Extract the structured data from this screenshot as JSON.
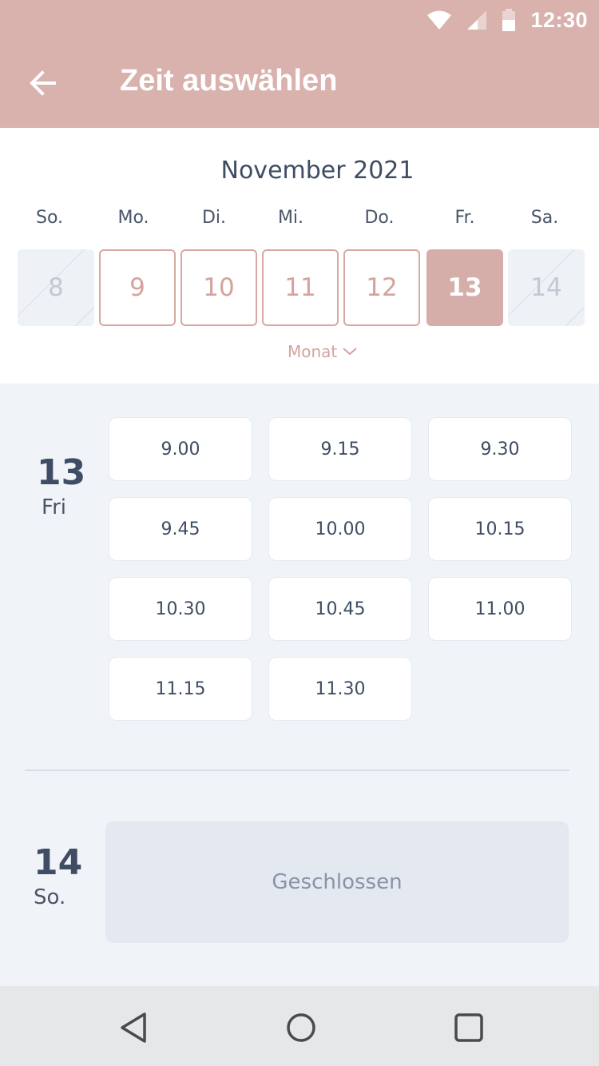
{
  "status": {
    "time": "12:30"
  },
  "header": {
    "title": "Zeit auswählen",
    "back_icon": "arrow-left-icon"
  },
  "calendar": {
    "month": "November 2021",
    "weekdays": [
      "So.",
      "Mo.",
      "Di.",
      "Mi.",
      "Do.",
      "Fr.",
      "Sa."
    ],
    "days": [
      {
        "num": "8",
        "state": "closed"
      },
      {
        "num": "9",
        "state": "open"
      },
      {
        "num": "10",
        "state": "open"
      },
      {
        "num": "11",
        "state": "open"
      },
      {
        "num": "12",
        "state": "open"
      },
      {
        "num": "13",
        "state": "selected"
      },
      {
        "num": "14",
        "state": "closed"
      }
    ],
    "month_toggle": "Monat"
  },
  "day1": {
    "num": "13",
    "name": "Fri",
    "slots": [
      "9.00",
      "9.15",
      "9.30",
      "9.45",
      "10.00",
      "10.15",
      "10.30",
      "10.45",
      "11.00",
      "11.15",
      "11.30"
    ]
  },
  "day2": {
    "num": "14",
    "name": "So.",
    "closed_text": "Geschlossen"
  },
  "colors": {
    "accent": "#d9b1ad",
    "text": "#3f4c63",
    "background": "#f0f3f8"
  }
}
